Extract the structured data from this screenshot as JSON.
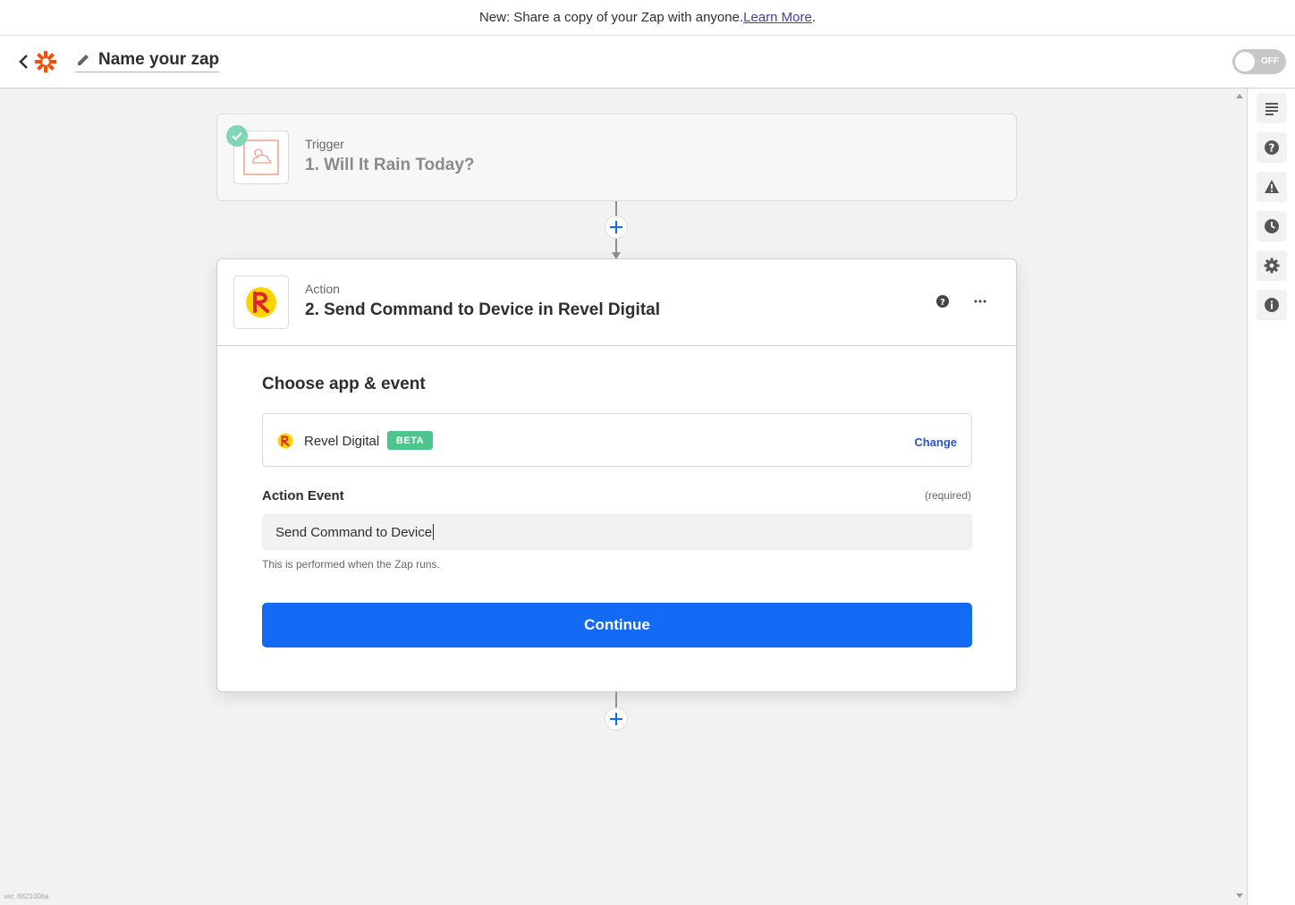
{
  "banner": {
    "text": "New: Share a copy of your Zap with anyone. ",
    "link": "Learn More",
    "suffix": "."
  },
  "header": {
    "zap_name": "Name your zap",
    "toggle_label": "OFF"
  },
  "trigger": {
    "label": "Trigger",
    "title": "1. Will It Rain Today?"
  },
  "action": {
    "label": "Action",
    "title": "2. Send Command to Device in Revel Digital",
    "section_title": "Choose app & event",
    "app_name": "Revel Digital",
    "badge": "BETA",
    "change_label": "Change",
    "event_label": "Action Event",
    "required_label": "(required)",
    "event_value": "Send Command to Device",
    "help_text": "This is performed when the Zap runs.",
    "continue_label": "Continue"
  },
  "sidebar": {
    "icons": [
      "list-icon",
      "help-icon",
      "warning-icon",
      "history-icon",
      "settings-icon",
      "info-icon"
    ]
  },
  "version": "ver. 682100ba",
  "colors": {
    "primary": "#136bf5",
    "zapier_orange": "#ff4a00",
    "beta_green": "#4fc58e",
    "success_green": "#7fd5b5",
    "link_blue": "#2a54c5"
  }
}
